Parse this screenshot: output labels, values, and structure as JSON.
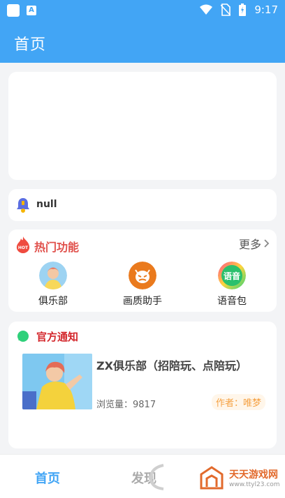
{
  "status_bar": {
    "time": "9:17",
    "icons": [
      "square-icon",
      "a-icon",
      "wifi-icon",
      "no-sim-icon",
      "battery-icon"
    ]
  },
  "app_bar": {
    "title": "首页"
  },
  "notice": {
    "text": "null",
    "icon": "bell-icon"
  },
  "hot": {
    "title": "热门功能",
    "badge_text": "HOT",
    "more_label": "更多",
    "items": [
      {
        "label": "俱乐部",
        "icon": "avatar-icon"
      },
      {
        "label": "画质助手",
        "icon": "devil-icon"
      },
      {
        "label": "语音包",
        "icon": "voice-icon",
        "icon_text": "语音"
      }
    ]
  },
  "official": {
    "title": "官方通知",
    "post": {
      "title": "ZX俱乐部（招陪玩、点陪玩）",
      "views_label": "浏览量：",
      "views": "9817",
      "author": "作者：唯梦"
    }
  },
  "tabbar": {
    "home": "首页",
    "discover": "发现"
  },
  "watermark": {
    "name": "天天游戏网",
    "url": "www.ttyl23.com"
  },
  "colors": {
    "primary": "#42a5f5",
    "hot_red": "#e0504b",
    "official_red": "#d3262b",
    "author_orange": "#f5a142"
  }
}
